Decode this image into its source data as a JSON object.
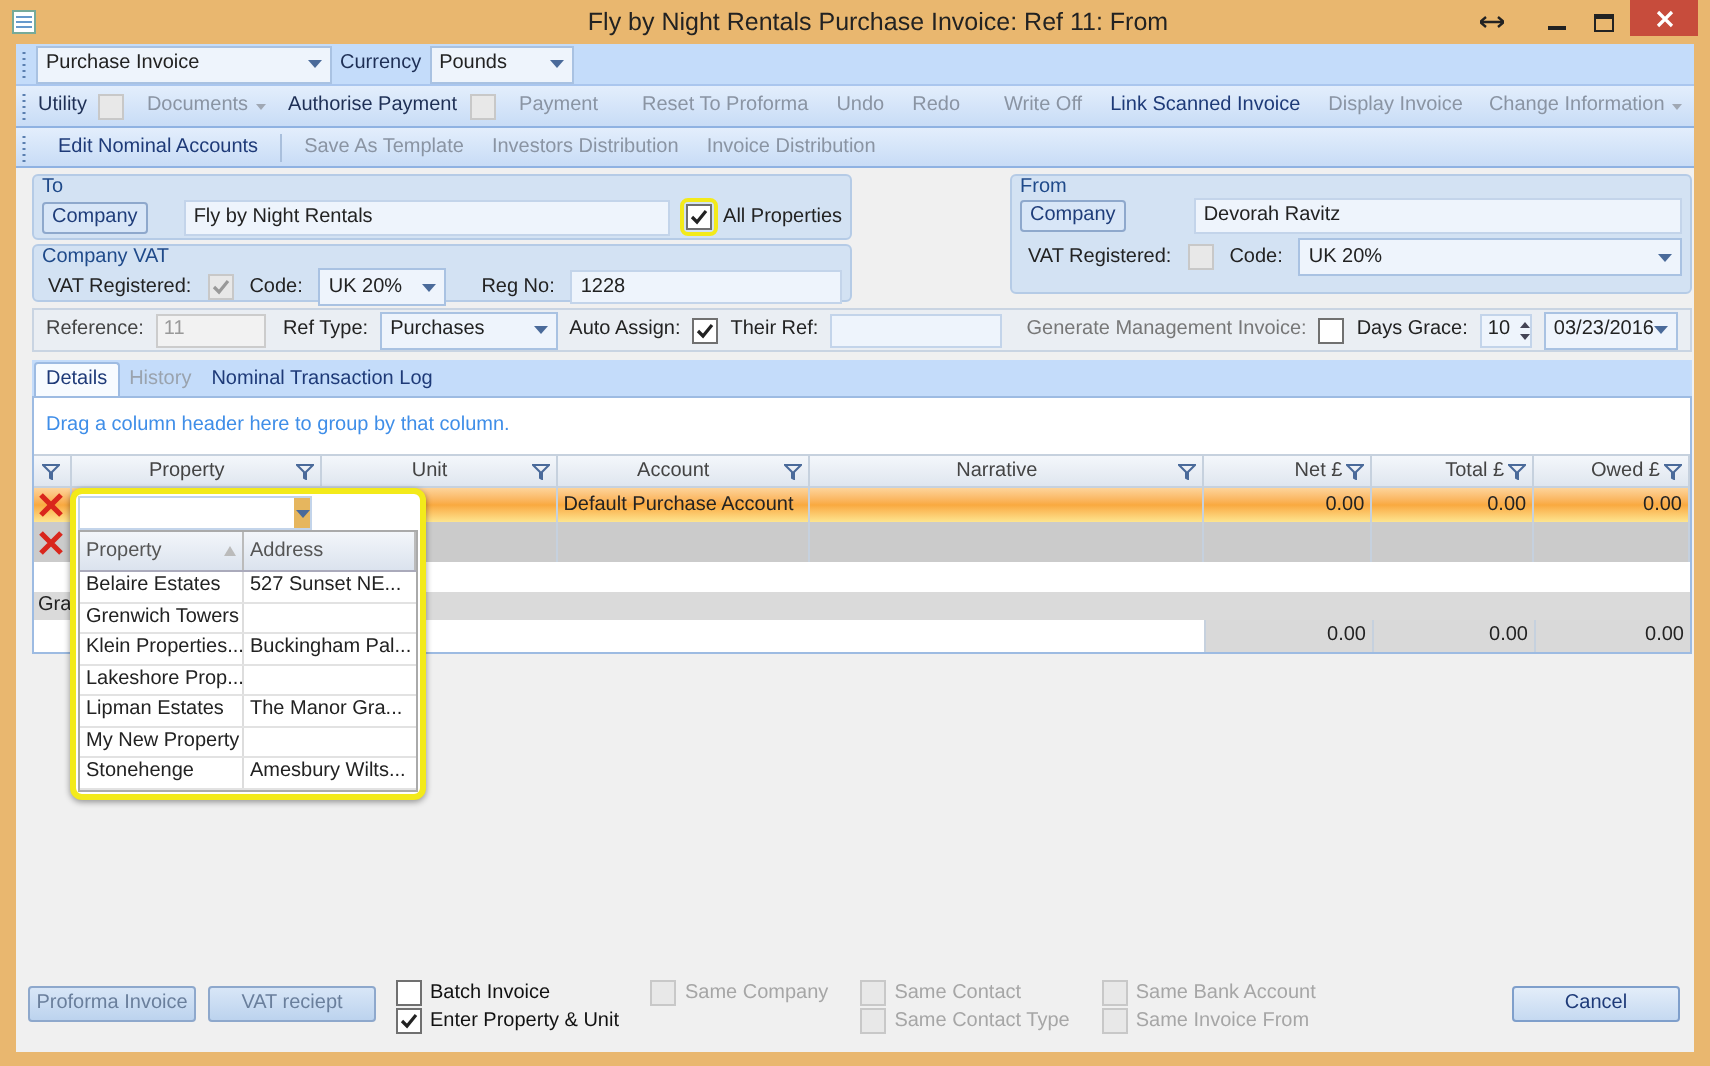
{
  "window": {
    "title": "Fly by Night Rentals Purchase Invoice: Ref 11: From"
  },
  "toolbar1": {
    "invoice_type": "Purchase Invoice",
    "currency_label": "Currency",
    "currency": "Pounds"
  },
  "toolbar2": [
    {
      "kind": "check",
      "label": "Utility",
      "disabled": false,
      "checked": false
    },
    {
      "kind": "dropdown",
      "label": "Documents",
      "disabled": true
    },
    {
      "kind": "check",
      "label": "Authorise Payment",
      "disabled": false,
      "checked": false
    },
    {
      "kind": "button",
      "label": "Payment",
      "disabled": true
    },
    {
      "kind": "separator"
    },
    {
      "kind": "button",
      "label": "Reset To Proforma",
      "disabled": true
    },
    {
      "kind": "button",
      "label": "Undo",
      "disabled": true
    },
    {
      "kind": "button",
      "label": "Redo",
      "disabled": true
    },
    {
      "kind": "separator"
    },
    {
      "kind": "button",
      "label": "Write Off",
      "disabled": true
    },
    {
      "kind": "button",
      "label": "Link Scanned Invoice",
      "disabled": false
    },
    {
      "kind": "button",
      "label": "Display Invoice",
      "disabled": true
    },
    {
      "kind": "dropdown",
      "label": "Change Information",
      "disabled": true
    }
  ],
  "toolbar3": [
    {
      "kind": "button",
      "label": "Edit Nominal Accounts",
      "disabled": false
    },
    {
      "kind": "separator"
    },
    {
      "kind": "button",
      "label": "Save As Template",
      "disabled": true
    },
    {
      "kind": "button",
      "label": "Investors Distribution",
      "disabled": true
    },
    {
      "kind": "button",
      "label": "Invoice Distribution",
      "disabled": true
    }
  ],
  "to": {
    "heading": "To",
    "company_button": "Company",
    "company": "Fly by Night Rentals",
    "all_properties": {
      "label": "All Properties",
      "checked": true
    }
  },
  "company_vat": {
    "heading": "Company VAT",
    "vat_registered_label": "VAT Registered:",
    "vat_registered": true,
    "code_label": "Code:",
    "code": "UK 20%",
    "reg_no_label": "Reg No:",
    "reg_no": "1228"
  },
  "from": {
    "heading": "From",
    "company_button": "Company",
    "company": "Devorah Ravitz",
    "vat_registered_label": "VAT Registered:",
    "vat_registered": false,
    "code_label": "Code:",
    "code": "UK 20%"
  },
  "reference_bar": {
    "reference_label": "Reference:",
    "reference": "11",
    "ref_type_label": "Ref Type:",
    "ref_type": "Purchases",
    "auto_assign_label": "Auto Assign:",
    "auto_assign": true,
    "their_ref_label": "Their Ref:",
    "generate_label": "Generate Management Invoice:",
    "generate": false,
    "days_grace_label": "Days Grace:",
    "days_grace": "10",
    "date": "03/23/2016"
  },
  "tabs": [
    {
      "label": "Details",
      "selected": true,
      "disabled": false
    },
    {
      "label": "History",
      "selected": false,
      "disabled": true
    },
    {
      "label": "Nominal Transaction Log",
      "selected": false,
      "disabled": false
    }
  ],
  "grid": {
    "group_hint": "Drag a column header here to group by that column.",
    "columns": [
      "Property",
      "Unit",
      "Account",
      "Narrative",
      "Net £",
      "Total £",
      "Owed £"
    ],
    "rows": [
      {
        "selected": true,
        "account": "Default Purchase Account",
        "net": "0.00",
        "total": "0.00",
        "owed": "0.00"
      },
      {
        "selected": false
      }
    ],
    "group_row": "Gra",
    "totals": [
      "0.00",
      "0.00",
      "0.00"
    ]
  },
  "property_dropdown": {
    "columns": [
      "Property",
      "Address"
    ],
    "rows": [
      {
        "property": "Belaire Estates",
        "address": "527 Sunset NE..."
      },
      {
        "property": "Grenwich Towers"
      },
      {
        "property": "Klein Properties...",
        "address": "Buckingham Pal..."
      },
      {
        "property": "Lakeshore Prop..."
      },
      {
        "property": "Lipman Estates",
        "address": "The Manor Gra..."
      },
      {
        "property": "My New Property"
      },
      {
        "property": "Stonehenge",
        "address": "Amesbury Wilts..."
      }
    ]
  },
  "footer": {
    "buttons": [
      "Proforma Invoice",
      "VAT reciept"
    ],
    "check_columns": [
      [
        {
          "label": "Batch Invoice",
          "checked": false,
          "disabled": false
        },
        {
          "label": "Enter Property & Unit",
          "checked": true,
          "disabled": false
        }
      ],
      [
        {
          "label": "Same Company",
          "checked": false,
          "disabled": true
        }
      ],
      [
        {
          "label": "Same Contact",
          "checked": false,
          "disabled": true
        },
        {
          "label": "Same Contact Type",
          "checked": false,
          "disabled": true
        }
      ],
      [
        {
          "label": "Same Bank Account",
          "checked": false,
          "disabled": true
        },
        {
          "label": "Same Invoice From",
          "checked": false,
          "disabled": true
        }
      ]
    ],
    "cancel": "Cancel"
  }
}
